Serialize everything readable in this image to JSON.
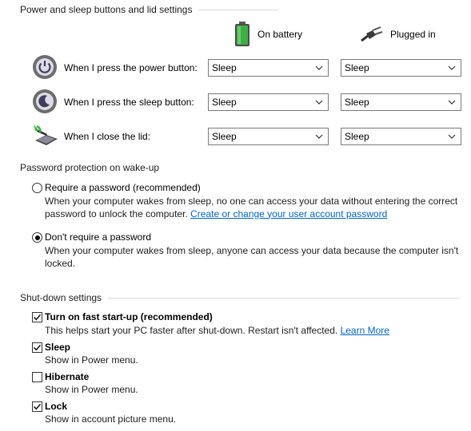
{
  "power_section": {
    "title": "Power and sleep buttons and lid settings",
    "col_battery": "On battery",
    "col_plugged": "Plugged in",
    "rows": [
      {
        "label": "When I press the power button:",
        "battery": "Sleep",
        "plugged": "Sleep",
        "icon": "power-button-icon"
      },
      {
        "label": "When I press the sleep button:",
        "battery": "Sleep",
        "plugged": "Sleep",
        "icon": "sleep-button-icon"
      },
      {
        "label": "When I close the lid:",
        "battery": "Sleep",
        "plugged": "Sleep",
        "icon": "laptop-lid-icon"
      }
    ]
  },
  "password_section": {
    "title": "Password protection on wake-up",
    "require": {
      "label": "Require a password (recommended)",
      "desc_line1": "When your computer wakes from sleep, no one can access your data without entering the correct",
      "desc_line2": "password to unlock the computer.",
      "link": "Create or change your user account password",
      "selected": false
    },
    "dont_require": {
      "label": "Don't require a password",
      "desc_line1": "When your computer wakes from sleep, anyone can access your data because the computer isn't",
      "desc_line2": "locked.",
      "selected": true
    }
  },
  "shutdown_section": {
    "title": "Shut-down settings",
    "items": [
      {
        "label": "Turn on fast start-up (recommended)",
        "desc": "This helps start your PC faster after shut-down. Restart isn't affected.",
        "link": "Learn More",
        "checked": true
      },
      {
        "label": "Sleep",
        "desc": "Show in Power menu.",
        "checked": true
      },
      {
        "label": "Hibernate",
        "desc": "Show in Power menu.",
        "checked": false
      },
      {
        "label": "Lock",
        "desc": "Show in account picture menu.",
        "checked": true
      }
    ]
  },
  "colors": {
    "link": "#0066cc",
    "check": "#000000",
    "battery_green": "#3cb043"
  }
}
